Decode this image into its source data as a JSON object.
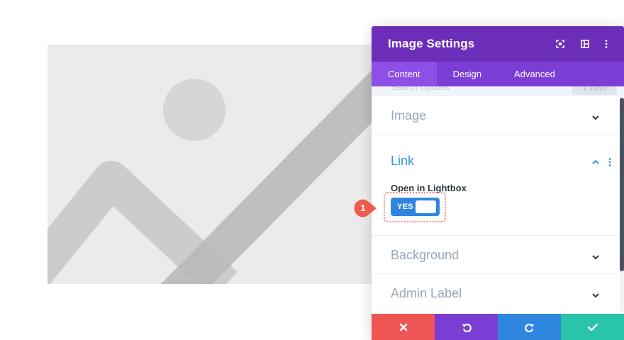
{
  "modal": {
    "title": "Image Settings",
    "header_icons": [
      "fullscreen-icon",
      "split-view-icon",
      "more-options-icon"
    ],
    "tabs": [
      {
        "label": "Content",
        "active": true
      },
      {
        "label": "Design",
        "active": false
      },
      {
        "label": "Advanced",
        "active": false
      }
    ],
    "search": {
      "placeholder": "Search Options",
      "filter_label": "+ Filter"
    },
    "sections": {
      "image": {
        "title": "Image",
        "expanded": false
      },
      "link": {
        "title": "Link",
        "expanded": true,
        "option_label": "Open in Lightbox",
        "toggle": {
          "label": "YES",
          "on": true
        }
      },
      "background": {
        "title": "Background",
        "expanded": false
      },
      "admin_label": {
        "title": "Admin Label",
        "expanded": false
      }
    },
    "footer_buttons": [
      {
        "name": "discard",
        "icon": "close-icon",
        "color": "#ef5555"
      },
      {
        "name": "undo",
        "icon": "undo-icon",
        "color": "#7b3ed4"
      },
      {
        "name": "redo",
        "icon": "redo-icon",
        "color": "#2f86df"
      },
      {
        "name": "save",
        "icon": "checkmark-icon",
        "color": "#29c4a9"
      }
    ]
  },
  "annotation": {
    "step_number": "1",
    "color": "#ef5a4a"
  },
  "colors": {
    "header": "#6c2eb9",
    "tabs": "#7b3ed4",
    "active_tab": "#8e4ee8",
    "link_accent": "#2e9bd6",
    "toggle": "#2f86df"
  }
}
